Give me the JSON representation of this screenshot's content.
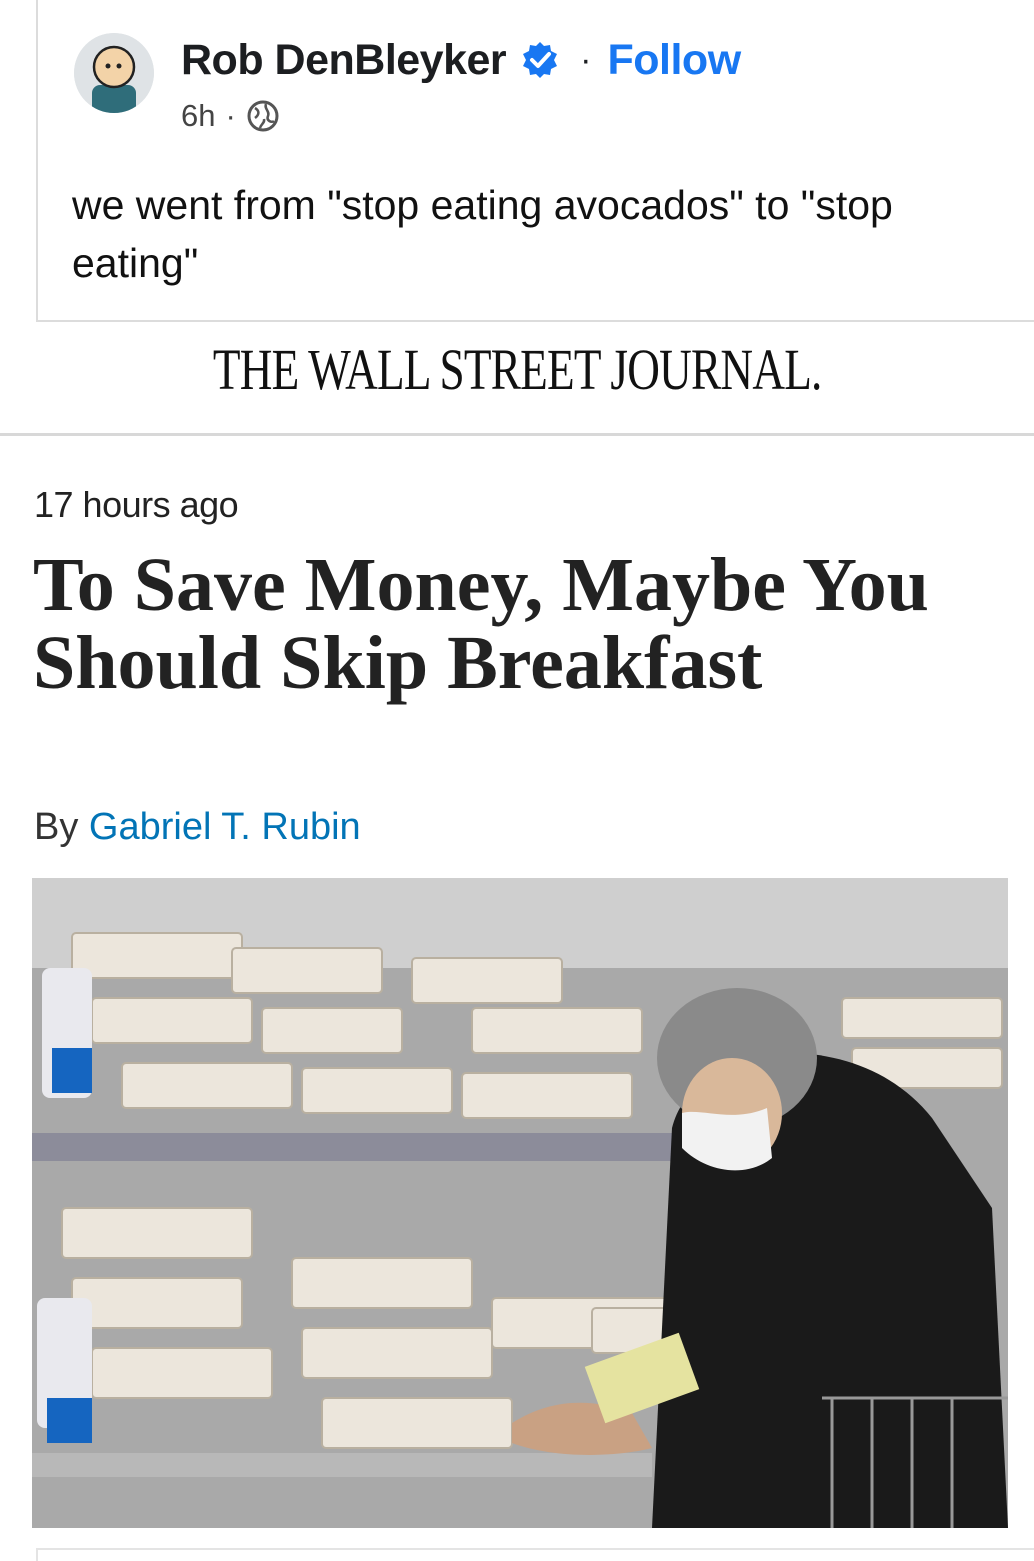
{
  "post": {
    "author": "Rob DenBleyker",
    "separator": "·",
    "follow_label": "Follow",
    "time": "6h",
    "meta_dot": "·",
    "text": "we went from \"stop eating avocados\" to \"stop eating\""
  },
  "article": {
    "publication": "THE WALL STREET JOURNAL.",
    "timestamp": "17 hours ago",
    "headline": "To Save Money, Maybe You Should Skip Breakfast",
    "byline_prefix": "By ",
    "byline_author": "Gabriel T. Rubin"
  },
  "colors": {
    "accent": "#1877f2",
    "byline_link": "#0274b6"
  },
  "icons": {
    "verified": "verified-badge-icon",
    "audience": "globe-icon"
  }
}
